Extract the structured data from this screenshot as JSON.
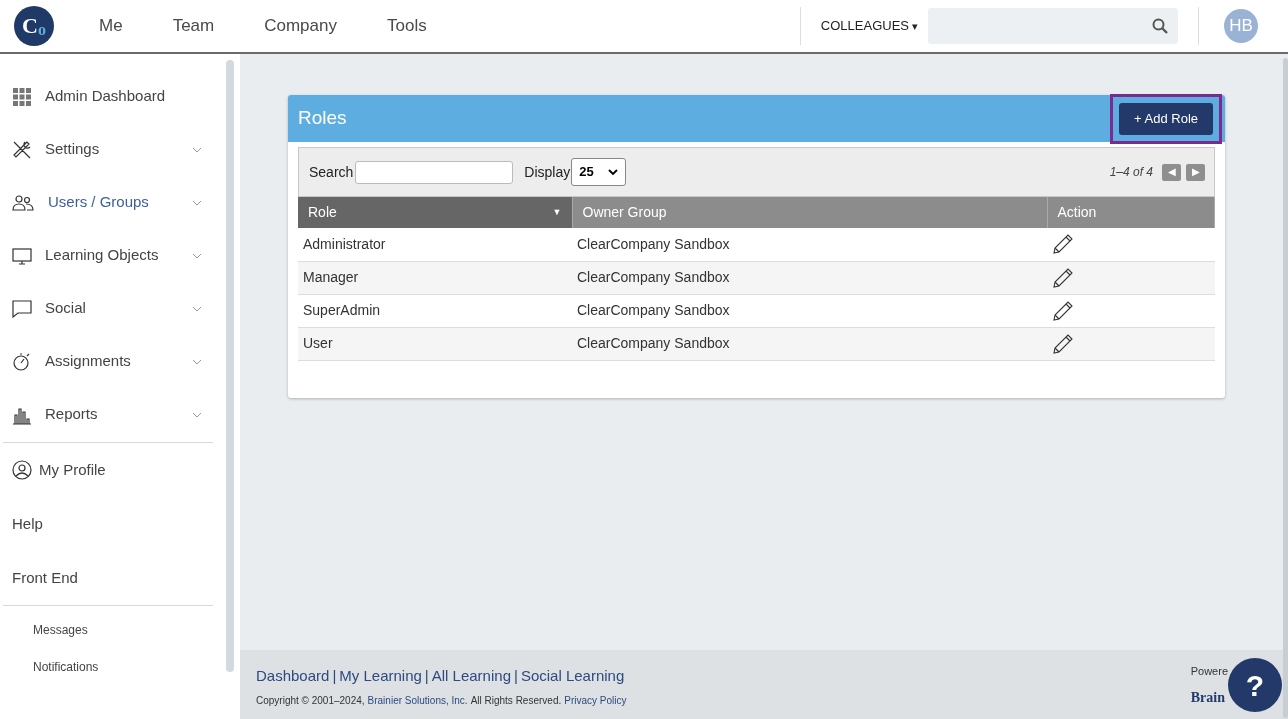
{
  "logo": {
    "letters": [
      "C",
      "o"
    ]
  },
  "nav": [
    {
      "label": "Me"
    },
    {
      "label": "Team"
    },
    {
      "label": "Company"
    },
    {
      "label": "Tools"
    }
  ],
  "colleagues": {
    "label": "COLLEAGUES",
    "caret": "▾"
  },
  "avatar": {
    "initials": "HB"
  },
  "sidebar": {
    "items": [
      {
        "label": "Admin Dashboard",
        "expandable": false,
        "selected": false
      },
      {
        "label": "Settings",
        "expandable": true,
        "selected": false
      },
      {
        "label": "Users / Groups",
        "expandable": true,
        "selected": true
      },
      {
        "label": "Learning Objects",
        "expandable": true,
        "selected": false
      },
      {
        "label": "Social",
        "expandable": true,
        "selected": false
      },
      {
        "label": "Assignments",
        "expandable": true,
        "selected": false
      },
      {
        "label": "Reports",
        "expandable": true,
        "selected": false
      }
    ],
    "links": [
      {
        "label": "My Profile",
        "kind": "icon"
      },
      {
        "label": "Help",
        "kind": "plain"
      },
      {
        "label": "Front End",
        "kind": "plain"
      }
    ],
    "small_links": [
      {
        "label": "Messages"
      },
      {
        "label": "Notifications"
      }
    ]
  },
  "panel": {
    "title": "Roles",
    "add_button": "+ Add Role",
    "search_label": "Search",
    "display_label": "Display",
    "display_value": "25",
    "range": "1–4 of 4",
    "prev": "◀",
    "next": "▶",
    "columns": [
      {
        "label": "Role",
        "sorted": true,
        "sort_icon": "▼"
      },
      {
        "label": "Owner Group",
        "sorted": false
      },
      {
        "label": "Action",
        "sorted": false
      }
    ],
    "rows": [
      {
        "role": "Administrator",
        "owner_group": "ClearCompany Sandbox"
      },
      {
        "role": "Manager",
        "owner_group": "ClearCompany Sandbox"
      },
      {
        "role": "SuperAdmin",
        "owner_group": "ClearCompany Sandbox"
      },
      {
        "role": "User",
        "owner_group": "ClearCompany Sandbox"
      }
    ]
  },
  "footer": {
    "links": [
      "Dashboard",
      "My Learning",
      "All Learning",
      "Social Learning"
    ],
    "separator": "|",
    "copyright": "Copyright © 2001–2024,",
    "company": "Brainier Solutions, Inc.",
    "rights": "All Rights Reserved.",
    "privacy": "Privacy Policy",
    "powered": "Powere",
    "brand": "Brain"
  },
  "help_button": {
    "label": "?"
  }
}
